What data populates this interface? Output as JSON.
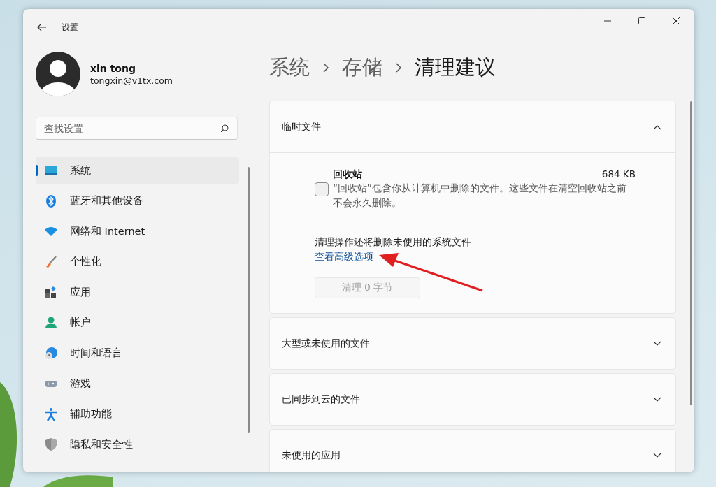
{
  "window": {
    "title": "设置"
  },
  "profile": {
    "name": "xin tong",
    "email": "tongxin@v1tx.com"
  },
  "search": {
    "placeholder": "查找设置"
  },
  "nav": [
    {
      "label": "系统",
      "selected": true
    },
    {
      "label": "蓝牙和其他设备",
      "selected": false
    },
    {
      "label": "网络和 Internet",
      "selected": false
    },
    {
      "label": "个性化",
      "selected": false
    },
    {
      "label": "应用",
      "selected": false
    },
    {
      "label": "帐户",
      "selected": false
    },
    {
      "label": "时间和语言",
      "selected": false
    },
    {
      "label": "游戏",
      "selected": false
    },
    {
      "label": "辅助功能",
      "selected": false
    },
    {
      "label": "隐私和安全性",
      "selected": false
    }
  ],
  "breadcrumb": [
    {
      "label": "系统",
      "selected": false
    },
    {
      "label": "存储",
      "selected": false
    },
    {
      "label": "清理建议",
      "selected": true
    }
  ],
  "sections": [
    {
      "title": "临时文件",
      "expanded": true,
      "items": [
        {
          "title": "回收站",
          "size": "684 KB",
          "description": "“回收站”包含你从计算机中删除的文件。这些文件在清空回收站之前不会永久删除。",
          "checked": false
        }
      ],
      "note": "清理操作还将删除未使用的系统文件",
      "link": "查看高级选项",
      "button": {
        "label": "清理 0 字节",
        "disabled": true
      }
    },
    {
      "title": "大型或未使用的文件",
      "expanded": false
    },
    {
      "title": "已同步到云的文件",
      "expanded": false
    },
    {
      "title": "未使用的应用",
      "expanded": false
    }
  ]
}
